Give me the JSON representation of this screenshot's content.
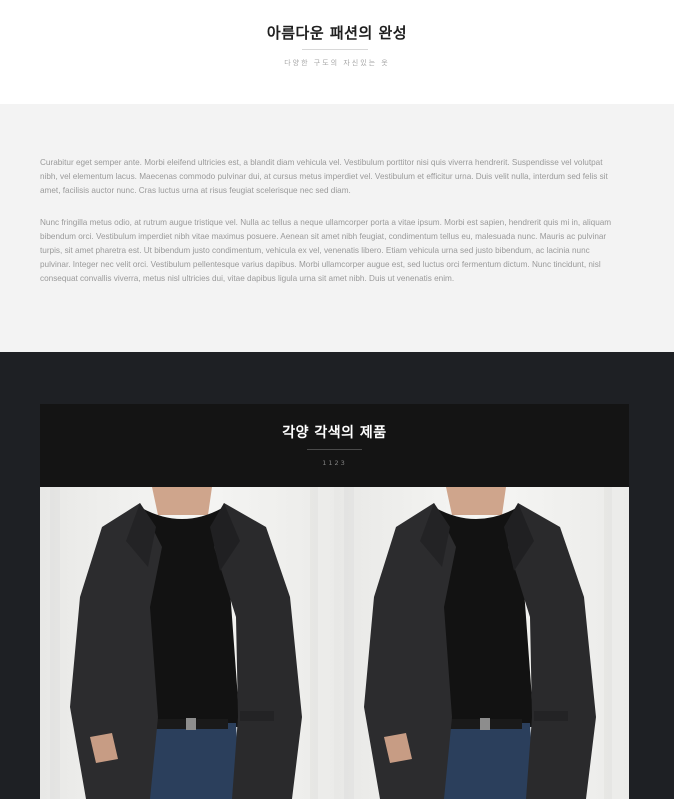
{
  "hero": {
    "title": "아름다운 패션의 완성",
    "subtitle": "다양한 구도의 자신있는 옷"
  },
  "intro": {
    "paragraphs": [
      "Curabitur eget semper ante. Morbi eleifend ultricies est, a blandit diam vehicula vel. Vestibulum porttitor nisi quis viverra hendrerit. Suspendisse vel volutpat nibh, vel elementum lacus. Maecenas commodo pulvinar dui, at cursus metus imperdiet vel. Vestibulum et efficitur urna. Duis velit nulla, interdum sed felis sit amet, facilisis auctor nunc. Cras luctus urna at risus feugiat scelerisque nec sed diam.",
      "Nunc fringilla metus odio, at rutrum augue tristique vel. Nulla ac tellus a neque ullamcorper porta a vitae ipsum. Morbi est sapien, hendrerit quis mi in, aliquam bibendum orci. Vestibulum imperdiet nibh vitae maximus posuere. Aenean sit amet nibh feugiat, condimentum tellus eu, malesuada nunc. Mauris ac pulvinar turpis, sit amet pharetra est. Ut bibendum justo condimentum, vehicula ex vel, venenatis libero. Etiam vehicula urna sed justo bibendum, ac lacinia nunc pulvinar. Integer nec velit orci. Vestibulum pellentesque varius dapibus. Morbi ullamcorper augue est, sed luctus orci fermentum dictum. Nunc tincidunt, nisl consequat convallis viverra, metus nisl ultricies dui, vitae dapibus ligula urna sit amet nibh. Duis ut venenatis enim."
    ]
  },
  "products": {
    "title": "각양 각색의 제품",
    "subtitle": "1123",
    "images": [
      {
        "name": "model-black-blazer-photo"
      },
      {
        "name": "model-black-blazer-photo"
      }
    ]
  },
  "colors": {
    "hero_bg": "#ffffff",
    "text_section_bg": "#f3f3f3",
    "dark_section_bg": "#1e2024",
    "product_box_bg": "#141414"
  }
}
